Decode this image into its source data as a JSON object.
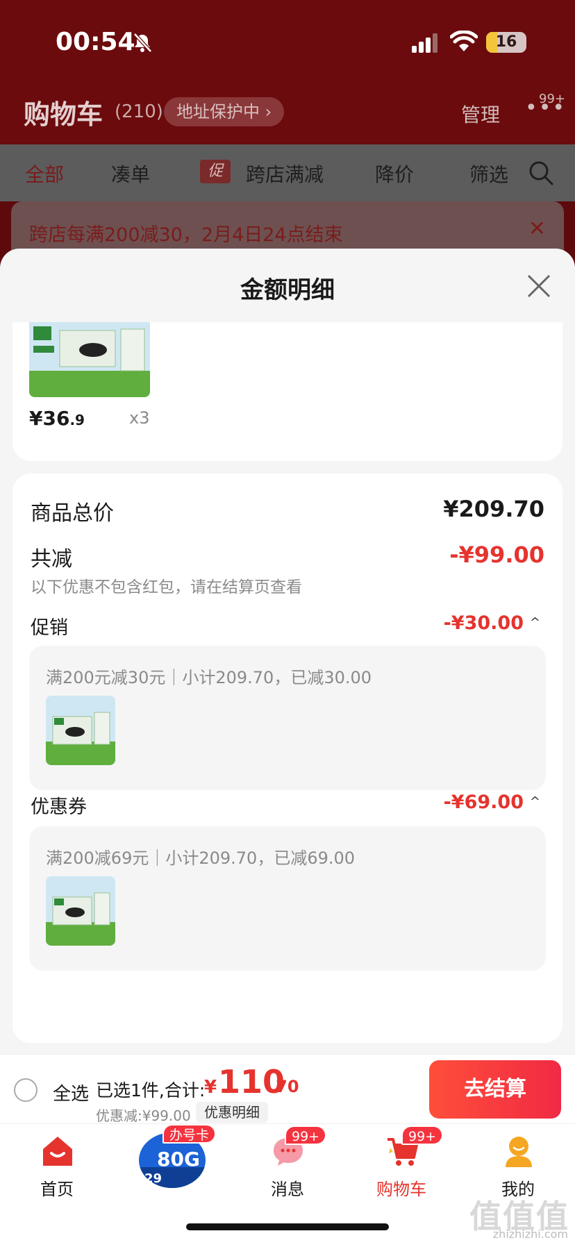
{
  "status_bar": {
    "time": "00:54",
    "battery": "16"
  },
  "header": {
    "title": "购物车",
    "count": "(210)",
    "address_protect": "地址保护中 ›",
    "manage": "管理",
    "more_badge": "99+"
  },
  "filter_tabs": [
    {
      "label": "全部"
    },
    {
      "label": "凑单"
    },
    {
      "label": "跨店满减",
      "tag": "促"
    },
    {
      "label": "降价"
    },
    {
      "label": "筛选"
    }
  ],
  "banner": {
    "text": "跨店每满200减30，2月4日24点结束"
  },
  "sheet": {
    "title": "金额明细",
    "product": {
      "price_main": "¥36",
      "price_decimal": ".9",
      "qty": "x3"
    },
    "summary": {
      "total_label": "商品总价",
      "total_value": "¥209.70",
      "reduce_label": "共减",
      "reduce_value": "-¥99.00",
      "reduce_note": "以下优惠不包含红包，请在结算页查看",
      "promo_label": "促销",
      "promo_value": "-¥30.00",
      "promo_detail": "满200元减30元｜小计209.70，已减30.00",
      "coupon_label": "优惠券",
      "coupon_value": "-¥69.00",
      "coupon_detail": "满200减69元｜小计209.70，已减69.00"
    }
  },
  "checkout": {
    "select_all": "全选",
    "selected_info": "已选1件,合计:",
    "total_currency": "¥",
    "total_int": "110",
    "total_dec": ".70",
    "discount": "优惠减:¥99.00",
    "detail_btn": "优惠明细",
    "pay_btn": "去结算"
  },
  "tabbar": {
    "home": "首页",
    "promo_badge": "办号卡",
    "promo_text": "80G",
    "promo_price": "29",
    "messages": "消息",
    "messages_badge": "99+",
    "cart": "购物车",
    "cart_badge": "99+",
    "mine": "我的"
  },
  "watermark": {
    "text": "值值值",
    "url": "zhizhizhi.com"
  },
  "colors": {
    "accent_red": "#e5332e",
    "header_dark_red": "#6b0b0d",
    "checkout_gradient": [
      "#ff4e3a",
      "#f02a44"
    ]
  }
}
